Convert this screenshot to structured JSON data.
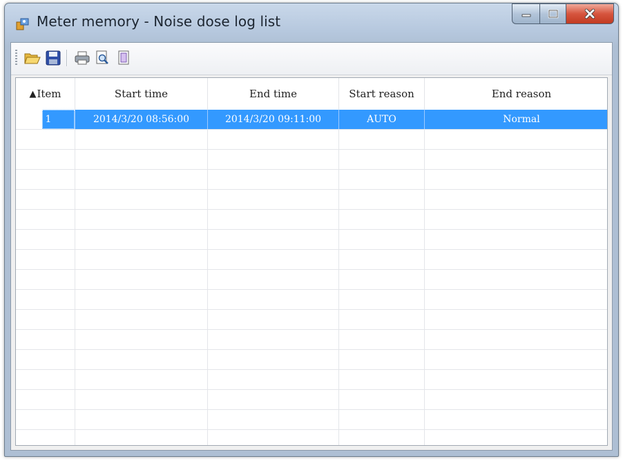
{
  "window": {
    "title": "Meter memory - Noise dose log list",
    "controls": {
      "minimize": "minimize",
      "maximize": "maximize",
      "close": "close"
    }
  },
  "toolbar": {
    "buttons": [
      {
        "name": "open",
        "icon": "folder-open-icon"
      },
      {
        "name": "save",
        "icon": "floppy-disk-icon"
      },
      {
        "name": "print",
        "icon": "printer-icon"
      },
      {
        "name": "print-preview",
        "icon": "print-preview-icon"
      },
      {
        "name": "page-setup",
        "icon": "page-setup-icon"
      }
    ]
  },
  "table": {
    "sort_indicator": "▲",
    "columns": [
      "Item",
      "Start time",
      "End time",
      "Start reason",
      "End reason"
    ],
    "rows": [
      {
        "item": "1",
        "start_time": "2014/3/20 08:56:00",
        "end_time": "2014/3/20 09:11:00",
        "start_reason": "AUTO",
        "end_reason": "Normal",
        "selected": true
      }
    ],
    "empty_row_count": 16
  },
  "colors": {
    "selection": "#3399ff",
    "title_bar": "#b6c8de",
    "close_button": "#d6553e"
  }
}
